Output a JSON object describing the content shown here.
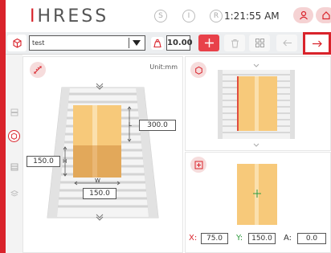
{
  "header": {
    "logo_text": "IHRESS",
    "modes": [
      "S",
      "I",
      "R"
    ],
    "time": "1:21:55 AM"
  },
  "toolbar": {
    "product_select": "test",
    "weight_value": "10.00"
  },
  "main": {
    "unit_label": "Unit:mm",
    "length_label": "L",
    "length_value": "300.0",
    "height_label": "H",
    "height_value": "150.0",
    "width_label": "W",
    "width_value": "150.0"
  },
  "position": {
    "x_label": "X:",
    "x_value": "75.0",
    "y_label": "Y:",
    "y_value": "150.0",
    "a_label": "A:",
    "a_value": "0.0"
  },
  "colors": {
    "brand_red": "#d9232b",
    "box_orange": "#f7c97a",
    "accent_green": "#2e9a3d"
  }
}
